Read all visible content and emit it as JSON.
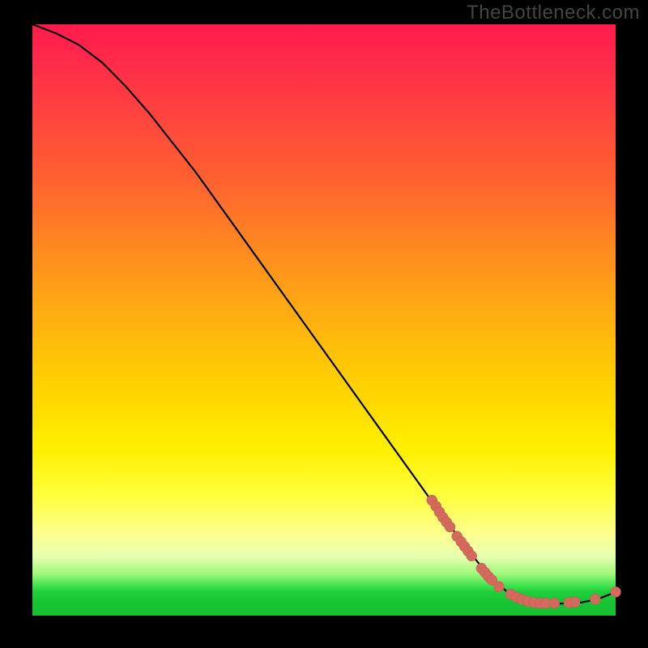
{
  "watermark": "TheBottleneck.com",
  "colors": {
    "background": "#000000",
    "curve": "#000000",
    "dot_fill": "#d46a5e",
    "dot_stroke": "#c05a4e"
  },
  "chart_data": {
    "type": "line",
    "title": "",
    "xlabel": "",
    "ylabel": "",
    "xlim": [
      0,
      100
    ],
    "ylim": [
      0,
      100
    ],
    "grid": false,
    "legend": false,
    "curve": [
      {
        "x": 0,
        "y": 100
      },
      {
        "x": 4,
        "y": 98.5
      },
      {
        "x": 8,
        "y": 96.5
      },
      {
        "x": 12,
        "y": 93.5
      },
      {
        "x": 16,
        "y": 89.5
      },
      {
        "x": 20,
        "y": 85
      },
      {
        "x": 28,
        "y": 75
      },
      {
        "x": 36,
        "y": 64
      },
      {
        "x": 44,
        "y": 53
      },
      {
        "x": 52,
        "y": 42
      },
      {
        "x": 60,
        "y": 31
      },
      {
        "x": 68,
        "y": 20
      },
      {
        "x": 74,
        "y": 12
      },
      {
        "x": 78,
        "y": 7
      },
      {
        "x": 82,
        "y": 3.5
      },
      {
        "x": 86,
        "y": 2
      },
      {
        "x": 90,
        "y": 2
      },
      {
        "x": 94,
        "y": 2.2
      },
      {
        "x": 97,
        "y": 2.8
      },
      {
        "x": 100,
        "y": 4
      }
    ],
    "dots": [
      {
        "x": 68.5,
        "y": 19.5
      },
      {
        "x": 69.2,
        "y": 18.5
      },
      {
        "x": 69.8,
        "y": 17.5
      },
      {
        "x": 70.4,
        "y": 16.6
      },
      {
        "x": 71.0,
        "y": 15.8
      },
      {
        "x": 71.6,
        "y": 15.0
      },
      {
        "x": 72.8,
        "y": 13.4
      },
      {
        "x": 73.5,
        "y": 12.5
      },
      {
        "x": 74.1,
        "y": 11.7
      },
      {
        "x": 74.7,
        "y": 10.9
      },
      {
        "x": 75.3,
        "y": 10.1
      },
      {
        "x": 77.0,
        "y": 8.0
      },
      {
        "x": 77.6,
        "y": 7.3
      },
      {
        "x": 78.2,
        "y": 6.6
      },
      {
        "x": 78.8,
        "y": 6.0
      },
      {
        "x": 80.0,
        "y": 4.9
      },
      {
        "x": 82.0,
        "y": 3.6
      },
      {
        "x": 83.0,
        "y": 3.1
      },
      {
        "x": 84.0,
        "y": 2.7
      },
      {
        "x": 85.0,
        "y": 2.4
      },
      {
        "x": 86.0,
        "y": 2.2
      },
      {
        "x": 87.0,
        "y": 2.1
      },
      {
        "x": 88.0,
        "y": 2.1
      },
      {
        "x": 89.5,
        "y": 2.1
      },
      {
        "x": 92.0,
        "y": 2.2
      },
      {
        "x": 93.0,
        "y": 2.3
      },
      {
        "x": 96.5,
        "y": 2.8
      },
      {
        "x": 100.0,
        "y": 4.0
      }
    ],
    "dot_radius": 6.5
  }
}
